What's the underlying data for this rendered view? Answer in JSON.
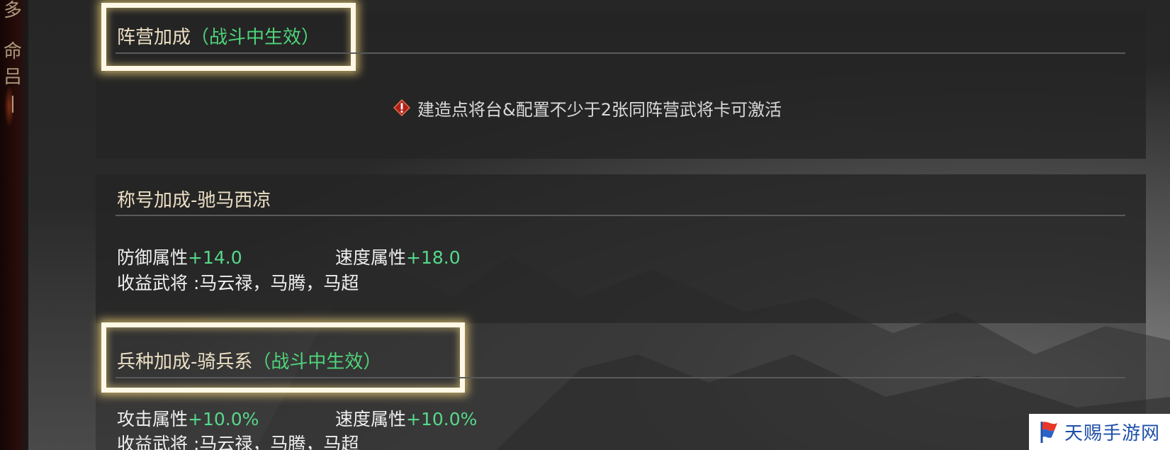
{
  "left_strip": {
    "glyphs": [
      "多",
      "命",
      "吕",
      "丨"
    ]
  },
  "faction_bonus": {
    "title": "阵营加成",
    "title_suffix": "（战斗中生效）",
    "notice": "建造点将台&配置不少于2张同阵营武将卡可激活",
    "notice_icon": "warning-icon",
    "highlighted": true
  },
  "title_bonus": {
    "title": "称号加成-驰马西凉",
    "stats": [
      {
        "label": "防御属性",
        "value": "+14.0"
      },
      {
        "label": "速度属性",
        "value": "+18.0"
      }
    ],
    "beneficiaries_label": "收益武将 :",
    "beneficiaries": "马云禄，马腾，马超"
  },
  "troop_bonus": {
    "title": "兵种加成-骑兵系",
    "title_suffix": "（战斗中生效）",
    "highlighted": true,
    "stats": [
      {
        "label": "攻击属性",
        "value": "+10.0%"
      },
      {
        "label": "速度属性",
        "value": "+10.0%"
      }
    ],
    "beneficiaries_label": "收益武将 :",
    "beneficiaries": "马云禄，马腾，马超"
  },
  "watermark": {
    "text": "天赐手游网",
    "logo": "flag-logo"
  },
  "colors": {
    "title": "#ecdfc4",
    "green": "#4fd47a",
    "highlight": "#fff8e6",
    "watermark_text": "#1e4fa8"
  }
}
